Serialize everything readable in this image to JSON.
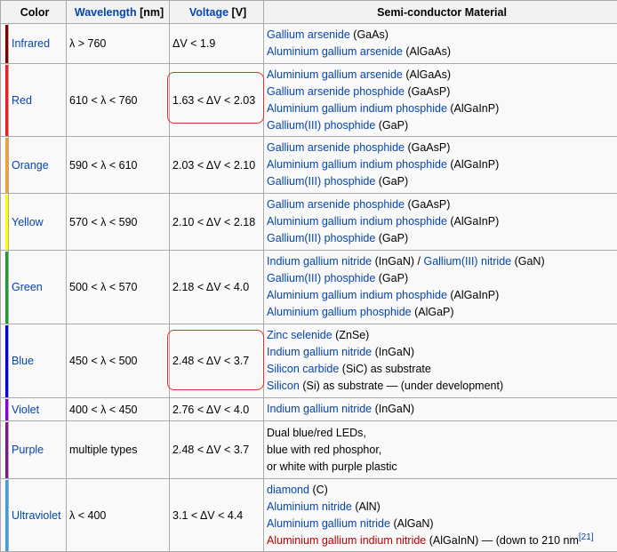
{
  "headers": {
    "color": "Color",
    "wavelength_link": "Wavelength",
    "wavelength_unit": "[nm]",
    "voltage_link": "Voltage",
    "voltage_unit": "[V]",
    "material": "Semi-conductor Material"
  },
  "rows": [
    {
      "color_name": "Infrared",
      "swatch": "#800000",
      "wavelength": "λ > 760",
      "voltage": "ΔV < 1.9",
      "materials": [
        [
          {
            "t": "Gallium arsenide",
            "l": true
          },
          {
            "t": " (GaAs)"
          }
        ],
        [
          {
            "t": "Aluminium gallium arsenide",
            "l": true
          },
          {
            "t": " (AlGaAs)"
          }
        ]
      ]
    },
    {
      "color_name": "Red",
      "swatch": "#ee1c25",
      "wavelength": "610 < λ < 760",
      "voltage": "1.63 < ΔV < 2.03",
      "materials": [
        [
          {
            "t": "Aluminium gallium arsenide",
            "l": true
          },
          {
            "t": " (AlGaAs)"
          }
        ],
        [
          {
            "t": "Gallium arsenide phosphide",
            "l": true
          },
          {
            "t": " (GaAsP)"
          }
        ],
        [
          {
            "t": "Aluminium gallium indium phosphide",
            "l": true
          },
          {
            "t": " (AlGaInP)"
          }
        ],
        [
          {
            "t": "Gallium(III) phosphide",
            "l": true
          },
          {
            "t": " (GaP)"
          }
        ]
      ]
    },
    {
      "color_name": "Orange",
      "swatch": "#f7a128",
      "wavelength": "590 < λ < 610",
      "voltage": "2.03 < ΔV < 2.10",
      "materials": [
        [
          {
            "t": "Gallium arsenide phosphide",
            "l": true
          },
          {
            "t": " (GaAsP)"
          }
        ],
        [
          {
            "t": "Aluminium gallium indium phosphide",
            "l": true
          },
          {
            "t": " (AlGaInP)"
          }
        ],
        [
          {
            "t": "Gallium(III) phosphide",
            "l": true
          },
          {
            "t": " (GaP)"
          }
        ]
      ]
    },
    {
      "color_name": "Yellow",
      "swatch": "#ffff00",
      "wavelength": "570 < λ < 590",
      "voltage": "2.10 < ΔV < 2.18",
      "materials": [
        [
          {
            "t": "Gallium arsenide phosphide",
            "l": true
          },
          {
            "t": " (GaAsP)"
          }
        ],
        [
          {
            "t": "Aluminium gallium indium phosphide",
            "l": true
          },
          {
            "t": " (AlGaInP)"
          }
        ],
        [
          {
            "t": "Gallium(III) phosphide",
            "l": true
          },
          {
            "t": " (GaP)"
          }
        ]
      ]
    },
    {
      "color_name": "Green",
      "swatch": "#1f9b31",
      "wavelength": "500 < λ < 570",
      "voltage": "2.18 < ΔV < 4.0",
      "materials": [
        [
          {
            "t": "Indium gallium nitride",
            "l": true
          },
          {
            "t": " (InGaN) / "
          },
          {
            "t": "Gallium(III) nitride",
            "l": true
          },
          {
            "t": " (GaN)"
          }
        ],
        [
          {
            "t": "Gallium(III) phosphide",
            "l": true
          },
          {
            "t": " (GaP)"
          }
        ],
        [
          {
            "t": "Aluminium gallium indium phosphide",
            "l": true
          },
          {
            "t": " (AlGaInP)"
          }
        ],
        [
          {
            "t": "Aluminium gallium phosphide",
            "l": true
          },
          {
            "t": " (AlGaP)"
          }
        ]
      ]
    },
    {
      "color_name": "Blue",
      "swatch": "#0000d8",
      "wavelength": "450 < λ < 500",
      "voltage": "2.48 < ΔV < 3.7",
      "materials": [
        [
          {
            "t": "Zinc selenide",
            "l": true
          },
          {
            "t": " (ZnSe)"
          }
        ],
        [
          {
            "t": "Indium gallium nitride",
            "l": true
          },
          {
            "t": " (InGaN)"
          }
        ],
        [
          {
            "t": "Silicon carbide",
            "l": true
          },
          {
            "t": " (SiC) as substrate"
          }
        ],
        [
          {
            "t": "Silicon",
            "l": true
          },
          {
            "t": " (Si) as substrate — (under development)"
          }
        ]
      ]
    },
    {
      "color_name": "Violet",
      "swatch": "#8b00d6",
      "wavelength": "400 < λ < 450",
      "voltage": "2.76 < ΔV < 4.0",
      "materials": [
        [
          {
            "t": "Indium gallium nitride",
            "l": true
          },
          {
            "t": " (InGaN)"
          }
        ]
      ]
    },
    {
      "color_name": "Purple",
      "swatch": "#7b1a84",
      "wavelength": "multiple types",
      "voltage": "2.48 < ΔV < 3.7",
      "materials": [
        [
          {
            "t": "Dual blue/red LEDs,"
          }
        ],
        [
          {
            "t": "blue with red phosphor,"
          }
        ],
        [
          {
            "t": "or white with purple plastic"
          }
        ]
      ]
    },
    {
      "color_name": "Ultraviolet",
      "swatch": "#3aa0e0",
      "wavelength": "λ < 400",
      "voltage": "3.1 < ΔV < 4.4",
      "materials": [
        [
          {
            "t": "diamond",
            "l": true
          },
          {
            "t": " (C)"
          }
        ],
        [
          {
            "t": "Aluminium nitride",
            "l": true
          },
          {
            "t": " (AlN)"
          }
        ],
        [
          {
            "t": "Aluminium gallium nitride",
            "l": true
          },
          {
            "t": " (AlGaN)"
          }
        ],
        [
          {
            "t": "Aluminium gallium indium nitride",
            "l": true,
            "red": true
          },
          {
            "t": " (AlGaInN) — (down to 210 nm"
          },
          {
            "t": "[21]",
            "sup": true
          }
        ]
      ]
    }
  ]
}
